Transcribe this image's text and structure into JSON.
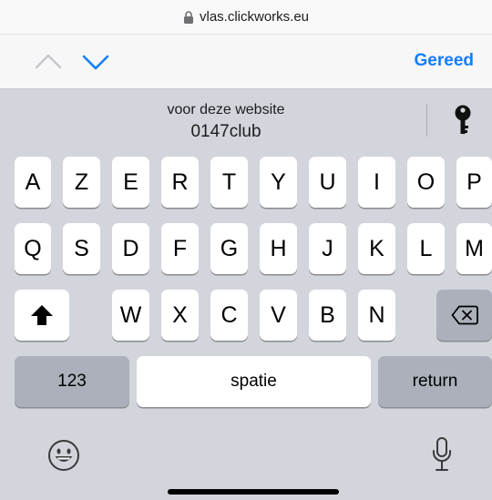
{
  "url_bar": {
    "domain": "vlas.clickworks.eu",
    "lock_icon": "lock-icon"
  },
  "accessory": {
    "prev_icon": "chevron-up-icon",
    "next_icon": "chevron-down-icon",
    "done_label": "Gereed",
    "colors": {
      "accent": "#147efb",
      "disabled": "#c7c7cc"
    }
  },
  "password_suggestion": {
    "caption": "voor deze website",
    "username": "0147club",
    "key_icon": "key-icon"
  },
  "keyboard": {
    "row1": [
      "A",
      "Z",
      "E",
      "R",
      "T",
      "Y",
      "U",
      "I",
      "O",
      "P"
    ],
    "row2": [
      "Q",
      "S",
      "D",
      "F",
      "G",
      "H",
      "J",
      "K",
      "L",
      "M"
    ],
    "row3": [
      "W",
      "X",
      "C",
      "V",
      "B",
      "N"
    ],
    "shift_icon": "shift-icon",
    "delete_icon": "backspace-icon",
    "numbers_label": "123",
    "space_label": "spatie",
    "return_label": "return",
    "emoji_icon": "emoji-icon",
    "mic_icon": "microphone-icon"
  }
}
